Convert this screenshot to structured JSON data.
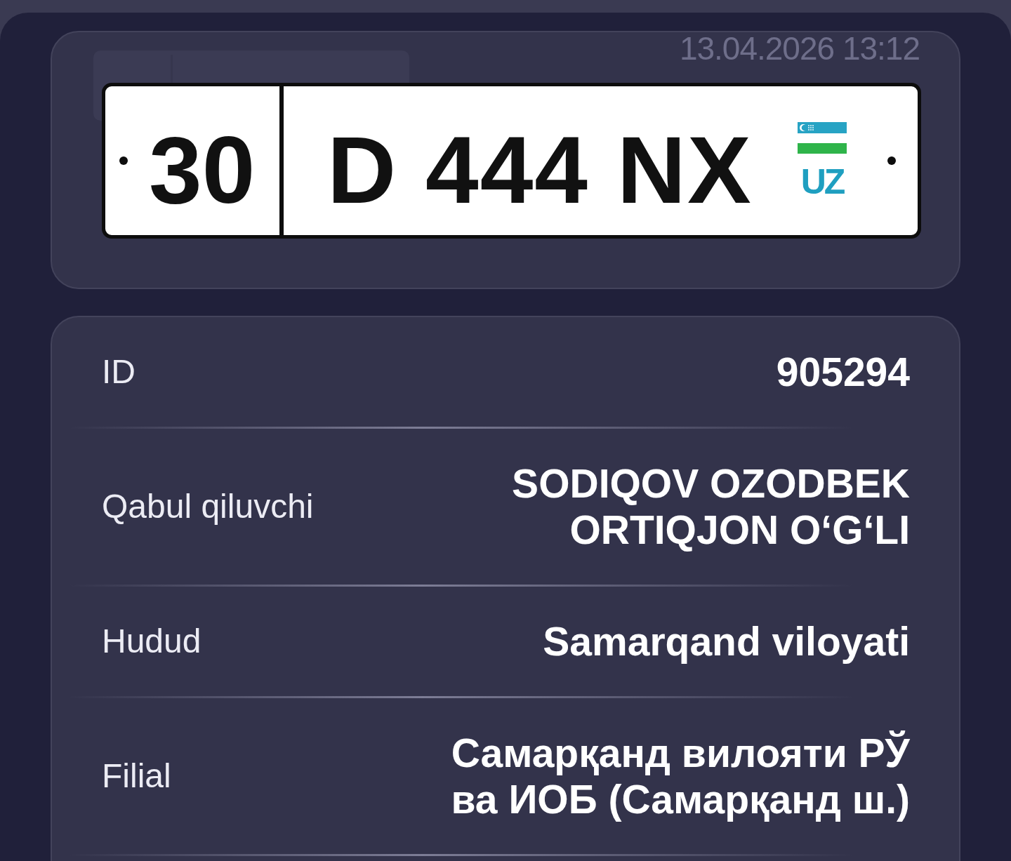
{
  "plate_card": {
    "timestamp": "13.04.2026 13:12",
    "plate": {
      "region": "30",
      "number": "D 444 NX",
      "country": "UZ"
    }
  },
  "details": [
    {
      "label": "ID",
      "value": "905294"
    },
    {
      "label": "Qabul qiluvchi",
      "value": "SODIQOV OZODBEK ORTIQJON O‘G‘LI"
    },
    {
      "label": "Hudud",
      "value": "Samarqand viloyati"
    },
    {
      "label": "Filial",
      "value": "Самарқанд вилояти РЎ ва ИОБ (Самарқанд ш.)"
    }
  ]
}
